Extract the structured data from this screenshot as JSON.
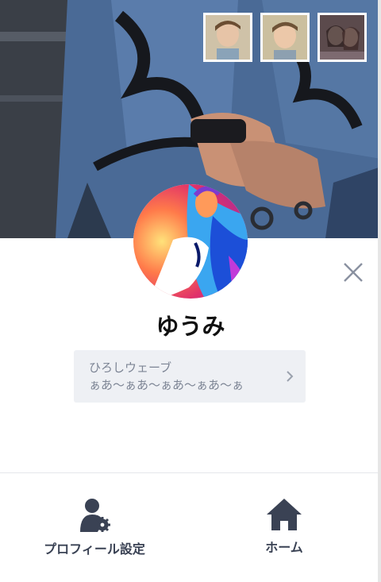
{
  "profile": {
    "name": "ゆうみ",
    "status_line1": "ひろしウェーブ",
    "status_line2": "ぁあ〜ぁあ〜ぁあ〜ぁあ〜ぁ"
  },
  "bottom_bar": {
    "profile_settings_label": "プロフィール設定",
    "home_label": "ホーム"
  },
  "icons": {
    "close": "close-icon",
    "chevron": "chevron-right-icon",
    "profile_settings": "person-gear-icon",
    "home": "home-icon"
  },
  "colors": {
    "accent": "#3a4254",
    "status_bg": "#eef0f4",
    "status_text": "#7c8494"
  }
}
